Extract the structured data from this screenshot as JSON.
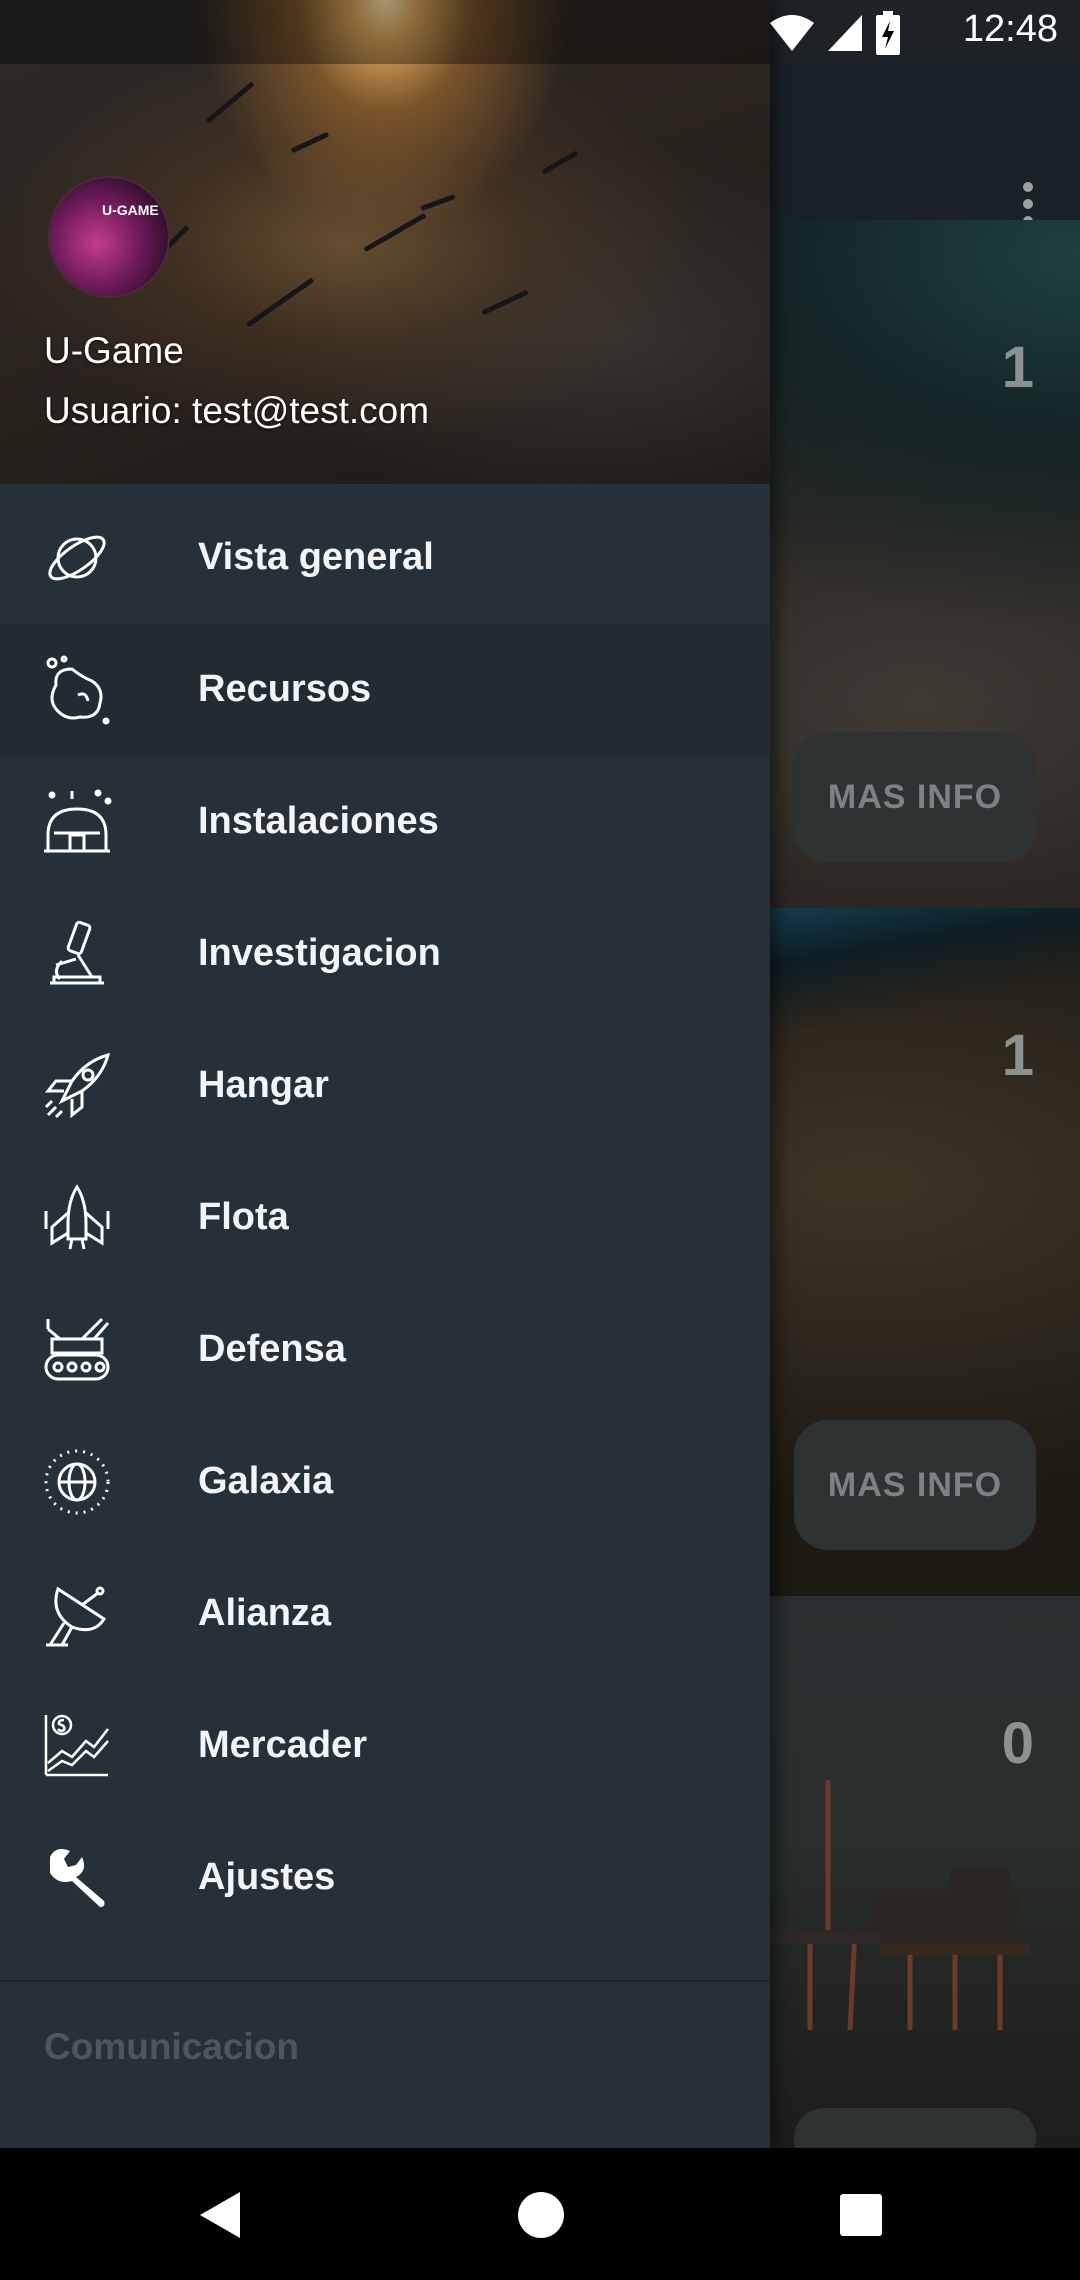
{
  "status_bar": {
    "time": "12:48",
    "icons": [
      "wifi-icon",
      "signal-icon",
      "battery-charging-icon"
    ]
  },
  "toolbar": {
    "overflow_icon": "more-vert-icon"
  },
  "cards": [
    {
      "count": "1",
      "button_label": "MAS INFO"
    },
    {
      "count": "1",
      "button_label": "MAS INFO"
    },
    {
      "count": "0"
    }
  ],
  "drawer": {
    "header": {
      "avatar_text": "U-GAME",
      "name": "U-Game",
      "email": "Usuario: test@test.com"
    },
    "menu_items": [
      {
        "label": "Vista general",
        "icon": "planet-icon",
        "selected": false
      },
      {
        "label": "Recursos",
        "icon": "asteroid-icon",
        "selected": true
      },
      {
        "label": "Instalaciones",
        "icon": "dome-icon",
        "selected": false
      },
      {
        "label": "Investigacion",
        "icon": "microscope-icon",
        "selected": false
      },
      {
        "label": "Hangar",
        "icon": "rocket-icon",
        "selected": false
      },
      {
        "label": "Flota",
        "icon": "starship-icon",
        "selected": false
      },
      {
        "label": "Defensa",
        "icon": "tank-icon",
        "selected": false
      },
      {
        "label": "Galaxia",
        "icon": "globe-icon",
        "selected": false
      },
      {
        "label": "Alianza",
        "icon": "satellite-dish-icon",
        "selected": false
      },
      {
        "label": "Mercader",
        "icon": "market-chart-icon",
        "selected": false
      },
      {
        "label": "Ajustes",
        "icon": "wrench-icon",
        "selected": false
      }
    ],
    "section_label": "Comunicacion"
  },
  "nav_bar": {
    "back_icon": "back-icon",
    "home_icon": "home-icon",
    "recents_icon": "recents-icon"
  },
  "colors": {
    "drawer_bg": "#263038",
    "selected_bg": "#222b31",
    "label_text": "#f2f4f5",
    "section_text": "#4b565d"
  }
}
